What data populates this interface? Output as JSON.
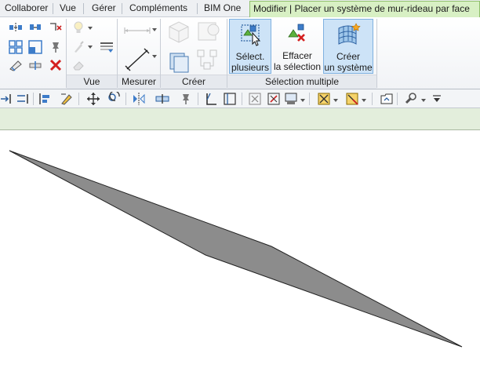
{
  "tabs": {
    "collaborer": "Collaborer",
    "vue": "Vue",
    "gerer": "Gérer",
    "complements": "Compléments",
    "bimone": "BIM One",
    "active": "Modifier | Placer un système de mur-rideau par face"
  },
  "panels": {
    "vue": "Vue",
    "mesurer": "Mesurer",
    "creer": "Créer",
    "selection_multiple": "Sélection multiple"
  },
  "buttons": {
    "select_plusieurs": {
      "line1": "Sélect.",
      "line2": "plusieurs",
      "active": true
    },
    "effacer_selection": {
      "line1": "Effacer",
      "line2": "la sélection"
    },
    "creer_systeme": {
      "line1": "Créer",
      "line2": "un système"
    }
  },
  "colors": {
    "active_tab": "#d8f0c4",
    "options_bar": "#e3eedc",
    "selected_button": "#cde3f7",
    "face_fill": "#8c8c8c",
    "face_edge": "#222222"
  },
  "icons": {
    "toolbar": [
      "align",
      "split",
      "offset",
      "paint",
      "move",
      "rotate",
      "mirror",
      "array",
      "pin",
      "trim",
      "trim-multi",
      "scale",
      "unpin",
      "hide",
      "override",
      "group",
      "view",
      "dropdown"
    ]
  }
}
